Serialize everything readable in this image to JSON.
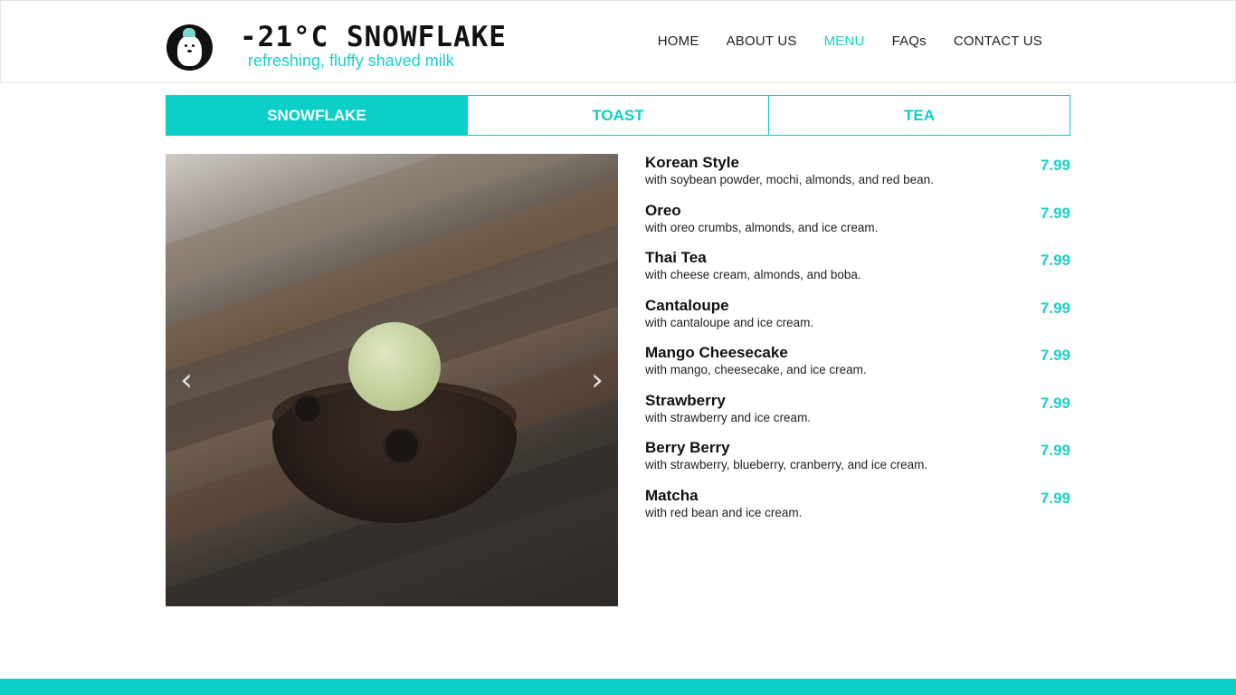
{
  "brand": {
    "title": "-21°C SNOWFLAKE",
    "tagline": "refreshing, fluffy shaved milk",
    "logo_icon": "polar-bear-logo"
  },
  "nav": {
    "items": [
      {
        "label": "HOME",
        "active": false
      },
      {
        "label": "ABOUT US",
        "active": false
      },
      {
        "label": "MENU",
        "active": true
      },
      {
        "label": "FAQs",
        "active": false
      },
      {
        "label": "CONTACT US",
        "active": false
      }
    ]
  },
  "tabs": [
    {
      "label": "SNOWFLAKE",
      "active": true
    },
    {
      "label": "TOAST",
      "active": false
    },
    {
      "label": "TEA",
      "active": false
    }
  ],
  "carousel": {
    "prev_icon": "chevron-left-icon",
    "next_icon": "chevron-right-icon",
    "prev_glyph": "‹",
    "next_glyph": "›"
  },
  "menu": {
    "items": [
      {
        "name": "Korean Style",
        "description": "with soybean powder, mochi, almonds, and red bean.",
        "price": "7.99"
      },
      {
        "name": "Oreo",
        "description": "with oreo crumbs, almonds, and ice cream.",
        "price": "7.99"
      },
      {
        "name": "Thai Tea",
        "description": "with cheese cream, almonds, and boba.",
        "price": "7.99"
      },
      {
        "name": "Cantaloupe",
        "description": "with cantaloupe and ice cream.",
        "price": "7.99"
      },
      {
        "name": "Mango Cheesecake",
        "description": "with mango, cheesecake, and ice cream.",
        "price": "7.99"
      },
      {
        "name": "Strawberry",
        "description": "with strawberry and ice cream.",
        "price": "7.99"
      },
      {
        "name": "Berry Berry",
        "description": "with strawberry, blueberry, cranberry, and ice cream.",
        "price": "7.99"
      },
      {
        "name": "Matcha",
        "description": "with red bean and ice cream.",
        "price": "7.99"
      }
    ]
  },
  "colors": {
    "accent": "#0ccfc8",
    "text": "#111111"
  }
}
